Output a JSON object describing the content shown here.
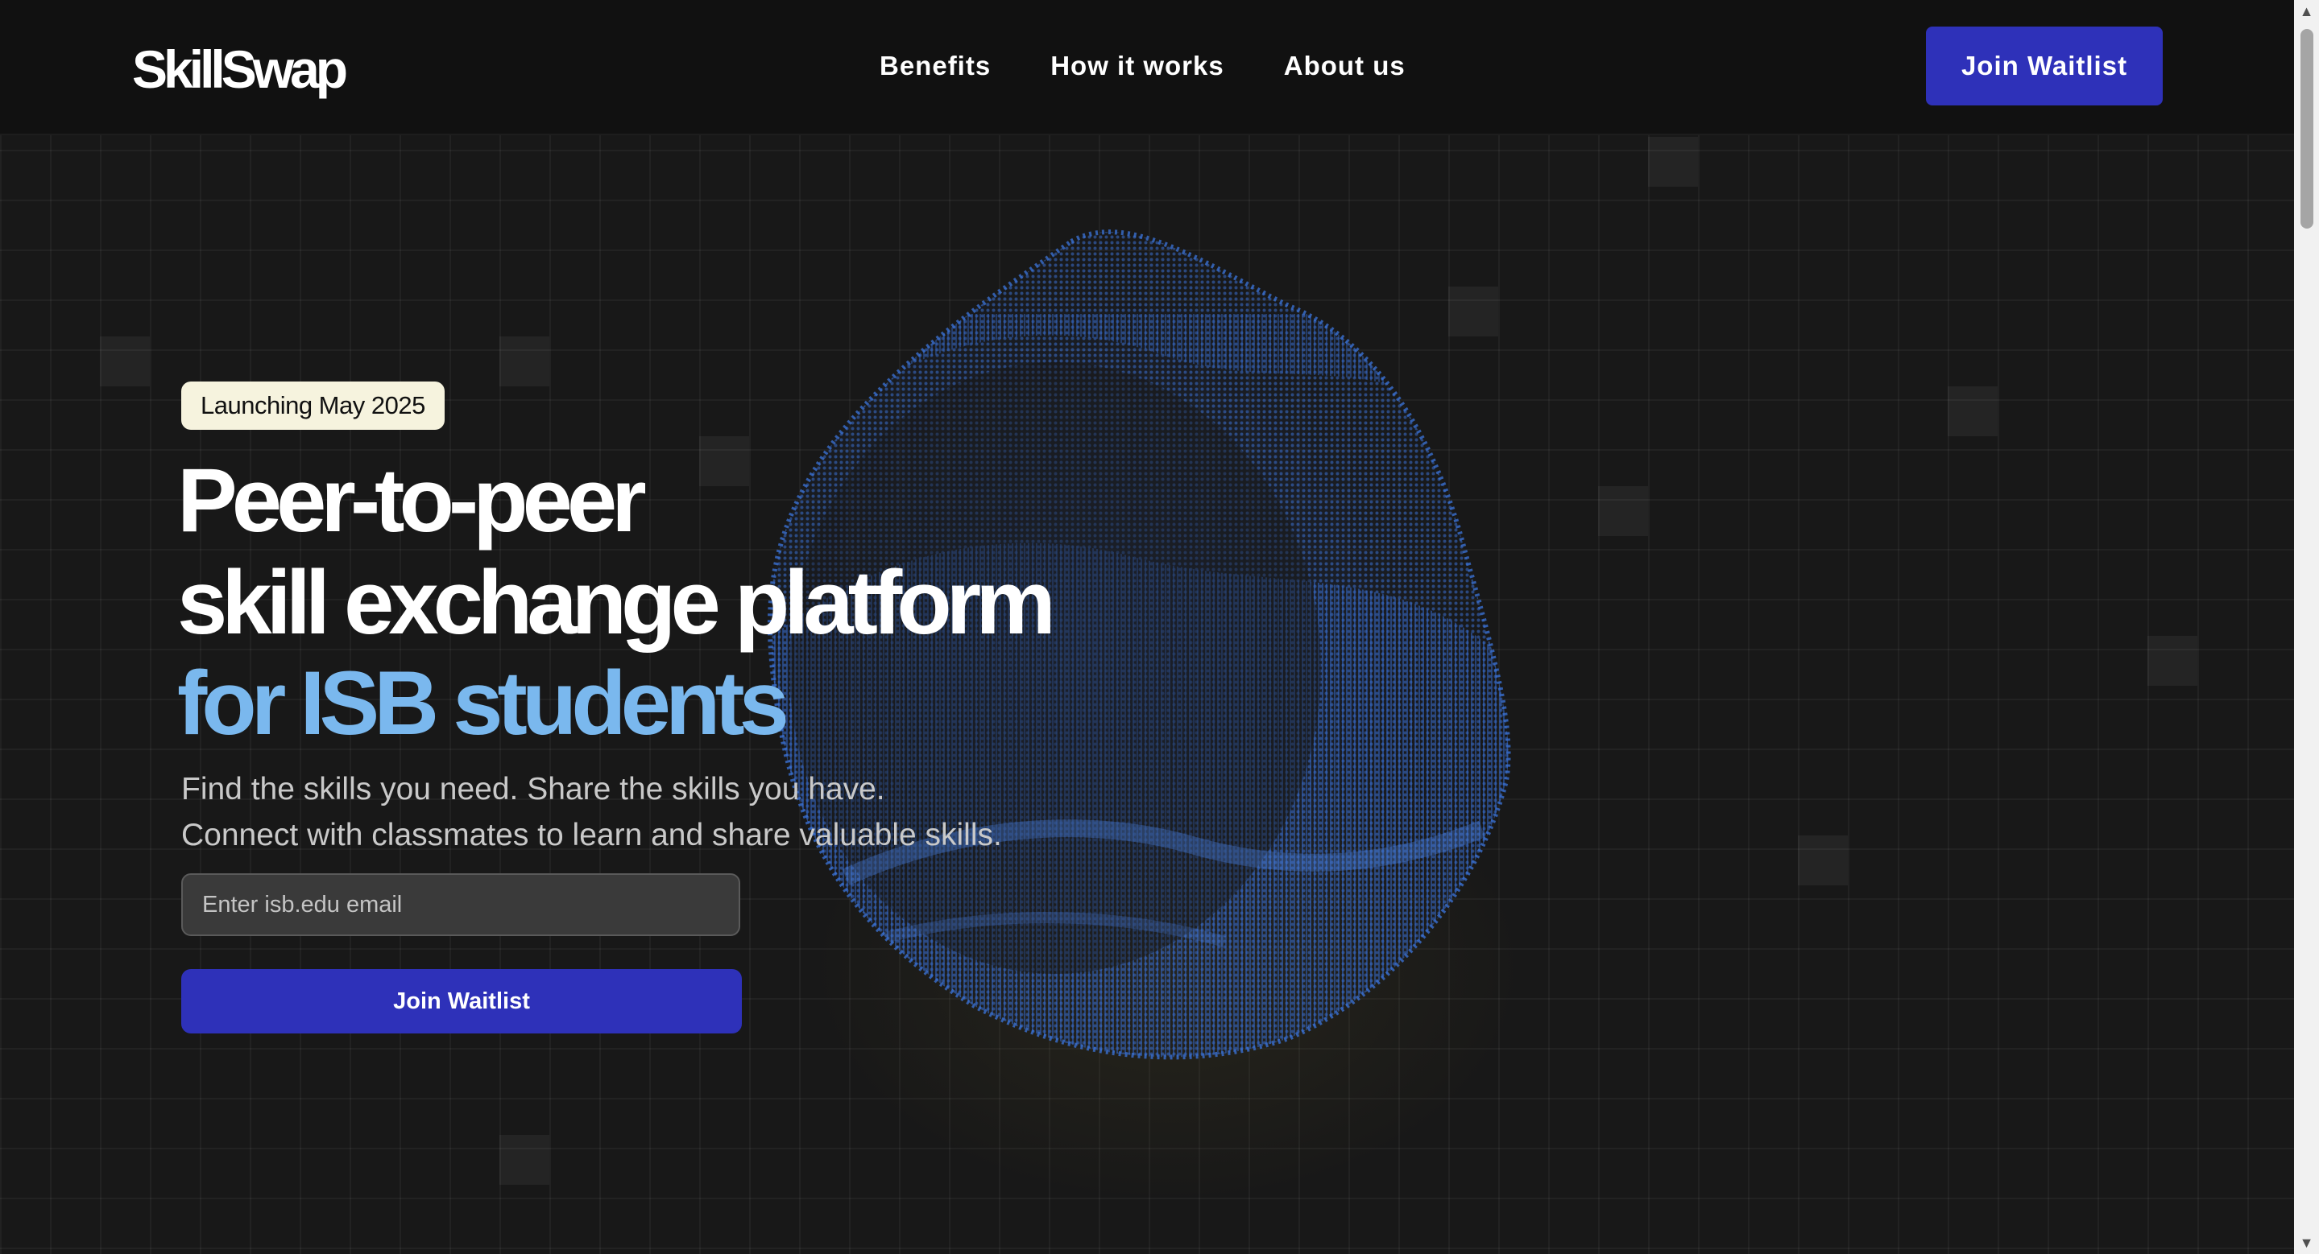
{
  "brand": {
    "logo_text": "SkillSwap"
  },
  "nav": {
    "items": [
      {
        "label": "Benefits"
      },
      {
        "label": "How it works"
      },
      {
        "label": "About us"
      }
    ]
  },
  "header": {
    "cta_label": "Join Waitlist"
  },
  "hero": {
    "badge": "Launching May 2025",
    "headline_line1": "Peer-to-peer",
    "headline_line2": "skill exchange platform",
    "headline_line3": "for ISB students",
    "subtext_line1": "Find the skills you need. Share the skills you have.",
    "subtext_line2": "Connect with classmates to learn and share valuable skills.",
    "email_placeholder": "Enter isb.edu email",
    "cta_label": "Join Waitlist"
  },
  "colors": {
    "background": "#181818",
    "header_bg": "#111111",
    "accent_button": "#2e31b9",
    "headline_accent": "#7ab8ee",
    "badge_bg": "#f6f3de",
    "blob_dots": "#3a6fd0"
  },
  "icons": {
    "scroll_up": "scroll-up-arrow-icon",
    "scroll_down": "scroll-down-arrow-icon"
  }
}
